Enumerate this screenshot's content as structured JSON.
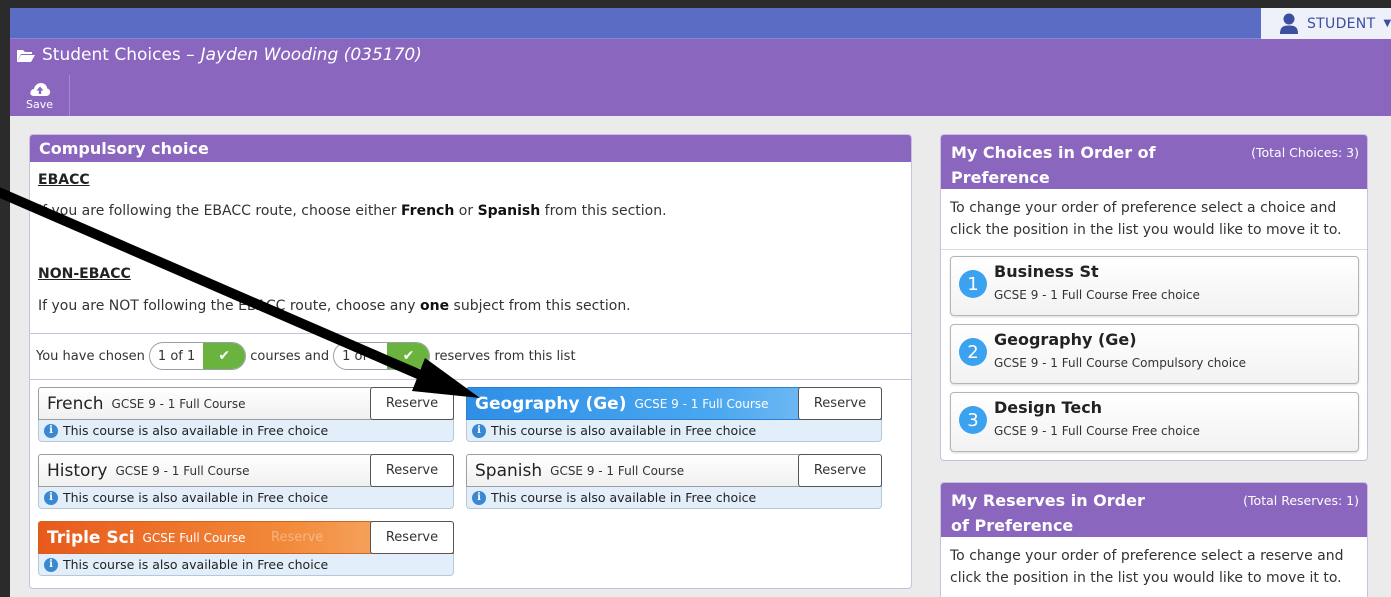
{
  "topbar": {
    "user_label": "STUDENT"
  },
  "header": {
    "title_prefix": "Student Choices – ",
    "student_name": "Jayden Wooding (035170)",
    "save_label": "Save"
  },
  "compulsory": {
    "heading": "Compulsory choice",
    "ebacc_heading": "EBACC",
    "ebacc_text": {
      "before": "If you are following the EBACC route, choose either ",
      "opt1": "French",
      "mid": " or ",
      "opt2": "Spanish",
      "after": " from this section."
    },
    "non_ebacc_heading": "NON-EBACC",
    "non_ebacc_text": {
      "before": "If you are NOT following the EBACC route, choose any ",
      "bold": "one",
      "after": " subject from this section."
    },
    "chosen": {
      "prefix": "You have chosen",
      "courses_value": "1 of 1",
      "mid": "courses and",
      "reserves_value": "1 of 1",
      "suffix": "reserves from this list"
    },
    "courses": [
      {
        "name": "French",
        "sub": "GCSE 9 - 1 Full Course",
        "reserve": "Reserve",
        "info": "This course is also available in Free choice"
      },
      {
        "name": "Geography (Ge)",
        "sub": "GCSE 9 - 1 Full Course",
        "reserve": "Reserve",
        "info": "This course is also available in Free choice"
      },
      {
        "name": "History",
        "sub": "GCSE 9 - 1 Full Course",
        "reserve": "Reserve",
        "info": "This course is also available in Free choice"
      },
      {
        "name": "Spanish",
        "sub": "GCSE 9 - 1 Full Course",
        "reserve": "Reserve",
        "info": "This course is also available in Free choice"
      },
      {
        "name": "Triple Sci",
        "sub": "GCSE Full Course",
        "reserve": "Reserve",
        "info": "This course is also available in Free choice",
        "ghost": "Reserve"
      }
    ]
  },
  "choices_panel": {
    "title": "My Choices in Order of Preference",
    "total": "(Total Choices: 3)",
    "instructions": "To change your order of preference select a choice and click the position in the list you would like to move it to.",
    "items": [
      {
        "num": "1",
        "name": "Business St",
        "sub": "GCSE 9 - 1 Full Course Free choice"
      },
      {
        "num": "2",
        "name": "Geography (Ge)",
        "sub": "GCSE 9 - 1 Full Course Compulsory choice"
      },
      {
        "num": "3",
        "name": "Design Tech",
        "sub": "GCSE 9 - 1 Full Course Free choice"
      }
    ]
  },
  "reserves_panel": {
    "title": "My Reserves in Order of Preference",
    "total": "(Total Reserves: 1)",
    "instructions": "To change your order of preference select a reserve and click the position in the list you would like to move it to."
  }
}
